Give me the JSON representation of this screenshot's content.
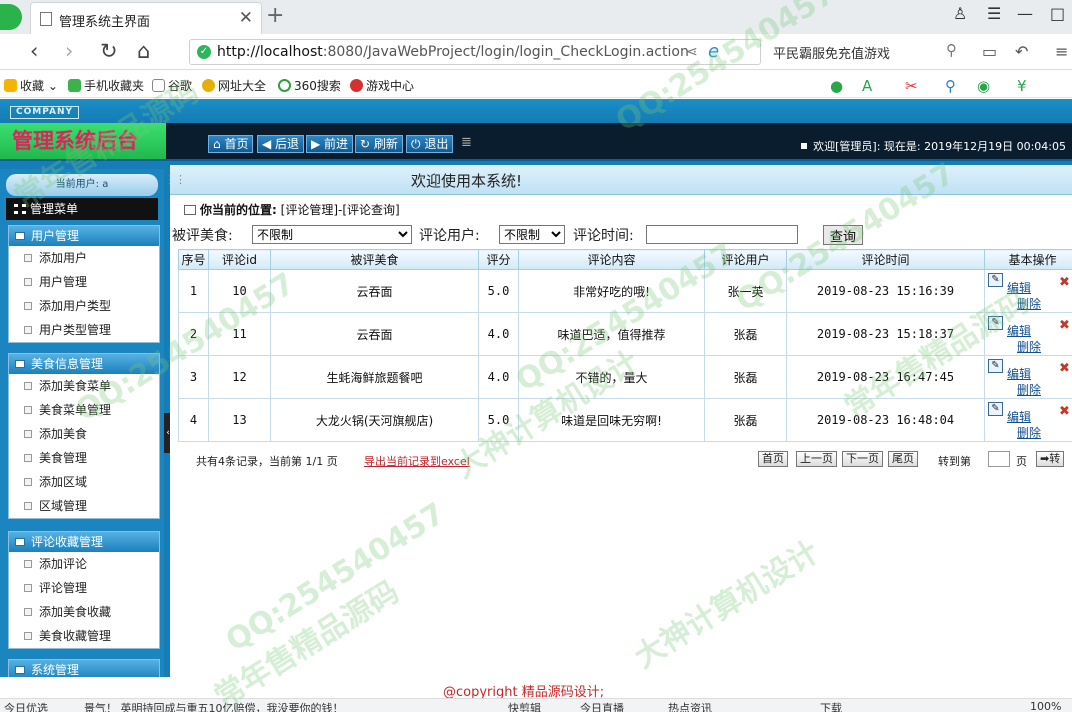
{
  "browser": {
    "tab_title": "管理系统主界面",
    "url_host": "http://localhost",
    "url_path": ":8080/JavaWebProject/login/login_CheckLogin.action",
    "search_text": "平民霸服免充值游戏",
    "bookmarks": [
      "收藏",
      "手机收藏夹",
      "谷歌",
      "网址大全",
      "360搜索",
      "游戏中心"
    ]
  },
  "header": {
    "company_badge": "COMPANY",
    "title": "管理系统后台",
    "nav_buttons": [
      "首页",
      "后退",
      "前进",
      "刷新",
      "退出"
    ],
    "welcome": "欢迎[管理员]:  现在是: 2019年12月19日 00:04:05"
  },
  "sidebar": {
    "current_user": "当前用户: a",
    "menu_title": "管理菜单",
    "groups": [
      {
        "title": "用户管理",
        "items": [
          "添加用户",
          "用户管理",
          "添加用户类型",
          "用户类型管理"
        ]
      },
      {
        "title": "美食信息管理",
        "items": [
          "添加美食菜单",
          "美食菜单管理",
          "添加美食",
          "美食管理",
          "添加区域",
          "区域管理"
        ]
      },
      {
        "title": "评论收藏管理",
        "items": [
          "添加评论",
          "评论管理",
          "添加美食收藏",
          "美食收藏管理"
        ]
      },
      {
        "title": "系统管理",
        "items": []
      }
    ]
  },
  "main": {
    "welcome_title": "欢迎使用本系统!",
    "breadcrumb_label": "你当前的位置:",
    "breadcrumb_path": "[评论管理]-[评论查询]",
    "filter": {
      "food_label": "被评美食:",
      "food_value": "不限制",
      "user_label": "评论用户:",
      "user_value": "不限制",
      "time_label": "评论时间:",
      "time_value": "",
      "query_button": "查询"
    },
    "table": {
      "columns": [
        "序号",
        "评论id",
        "被评美食",
        "评分",
        "评论内容",
        "评论用户",
        "评论时间",
        "基本操作"
      ],
      "rows": [
        [
          "1",
          "10",
          "云吞面",
          "5.0",
          "非常好吃的哦!",
          "张一英",
          "2019-08-23 15:16:39"
        ],
        [
          "2",
          "11",
          "云吞面",
          "4.0",
          "味道巴适，值得推荐",
          "张磊",
          "2019-08-23 15:18:37"
        ],
        [
          "3",
          "12",
          "生蚝海鲜旅题餐吧",
          "4.0",
          "不错的，量大",
          "张磊",
          "2019-08-23 16:47:45"
        ],
        [
          "4",
          "13",
          "大龙火锅(天河旗舰店)",
          "5.0",
          "味道是回味无穷啊!",
          "张磊",
          "2019-08-23 16:48:04"
        ]
      ],
      "edit_label": "编辑",
      "delete_label": "删除"
    },
    "pager": {
      "info": "共有4条记录，当前第 1/1 页",
      "export": "导出当前记录到excel",
      "first": "首页",
      "prev": "上一页",
      "next": "下一页",
      "last": "尾页",
      "goto_label": "转到第",
      "page_unit": "页",
      "go_button": "转"
    }
  },
  "footer": {
    "copyright": "@copyright 精品源码设计;"
  },
  "statusbar": {
    "left": "今日优选",
    "news": "景气！ 英明持回成与重五10亿赔偿，我没要你的钱！",
    "items": [
      "快剪辑",
      "今日直播",
      "热点资讯",
      "下载",
      "100%"
    ]
  },
  "watermarks": [
    "QQ:254540457",
    "常年售精品源码",
    "大神计算机设计"
  ]
}
